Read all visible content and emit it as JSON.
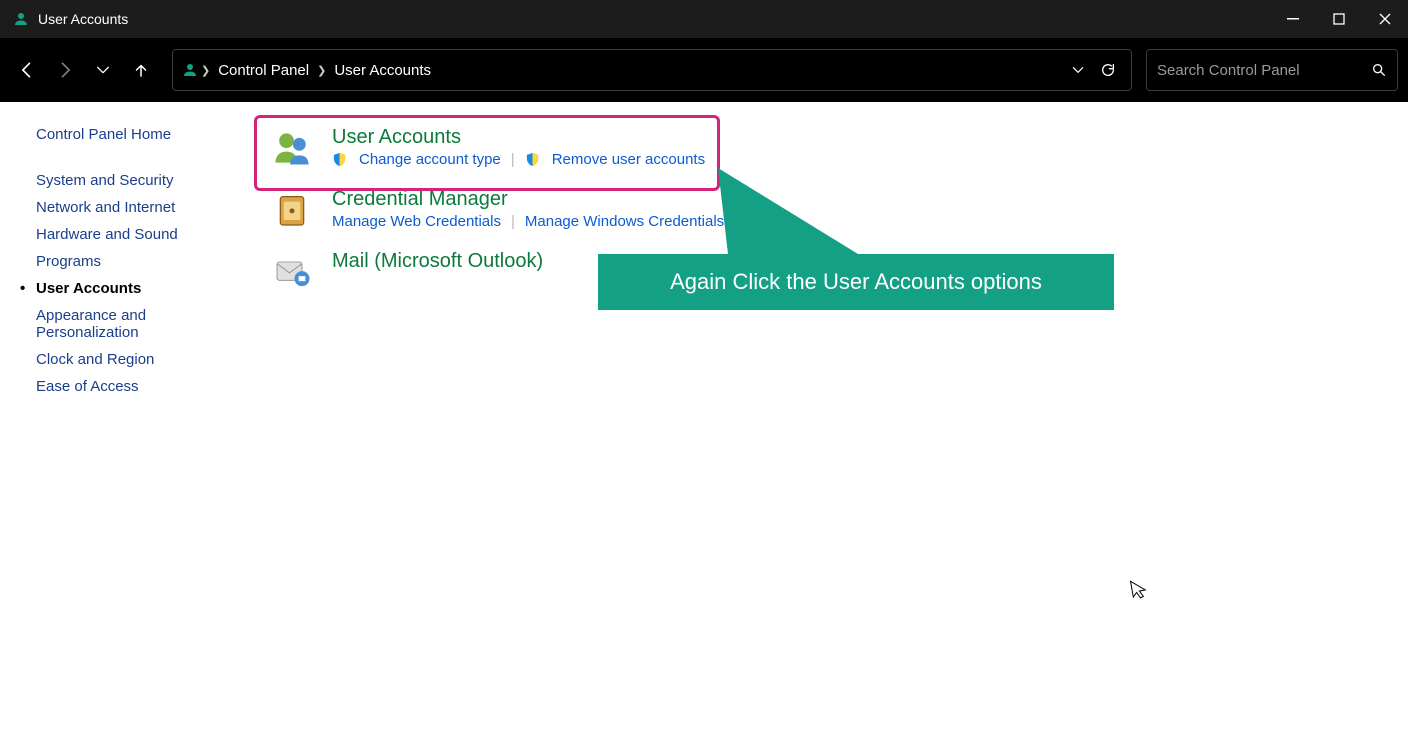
{
  "window": {
    "title": "User Accounts"
  },
  "breadcrumb": {
    "root": "Control Panel",
    "current": "User Accounts"
  },
  "search": {
    "placeholder": "Search Control Panel"
  },
  "sidebar": {
    "home": "Control Panel Home",
    "items": [
      {
        "label": "System and Security",
        "active": false
      },
      {
        "label": "Network and Internet",
        "active": false
      },
      {
        "label": "Hardware and Sound",
        "active": false
      },
      {
        "label": "Programs",
        "active": false
      },
      {
        "label": "User Accounts",
        "active": true
      },
      {
        "label": "Appearance and Personalization",
        "active": false
      },
      {
        "label": "Clock and Region",
        "active": false
      },
      {
        "label": "Ease of Access",
        "active": false
      }
    ]
  },
  "categories": [
    {
      "title": "User Accounts",
      "links": [
        {
          "label": "Change account type",
          "shield": true
        },
        {
          "label": "Remove user accounts",
          "shield": true
        }
      ],
      "highlighted": true
    },
    {
      "title": "Credential Manager",
      "links": [
        {
          "label": "Manage Web Credentials",
          "shield": false
        },
        {
          "label": "Manage Windows Credentials",
          "shield": false
        }
      ],
      "highlighted": false
    },
    {
      "title": "Mail (Microsoft Outlook)",
      "links": [],
      "highlighted": false
    }
  ],
  "callout": {
    "text": "Again Click the User Accounts options"
  }
}
